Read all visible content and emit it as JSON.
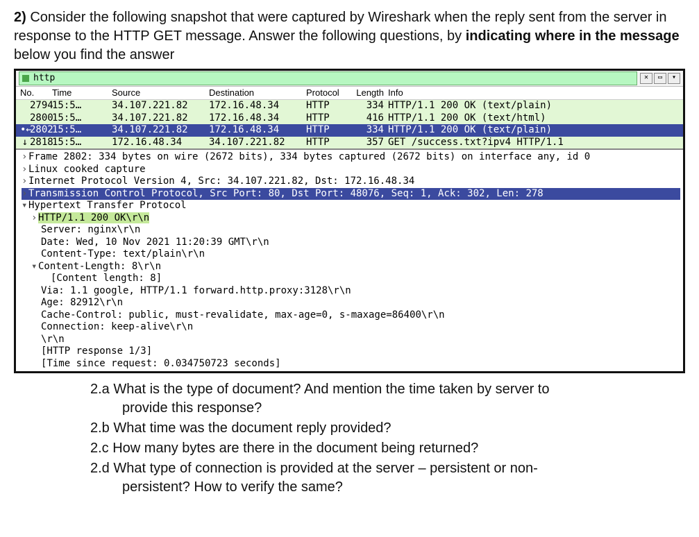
{
  "intro": {
    "num": "2)",
    "t1": " Consider the following snapshot that were captured by Wireshark when the reply sent from the server in response to the HTTP GET message. Answer the following questions, by ",
    "bold": "indicating where in the message",
    "t2": " below you find the answer"
  },
  "filter": {
    "text": "http",
    "btn_x": "✕",
    "btn_sq": "▭",
    "btn_dd": "▾"
  },
  "headers": {
    "no": "No.",
    "time": "Time",
    "src": "Source",
    "dst": "Destination",
    "prot": "Protocol",
    "len": "Length",
    "info": "Info"
  },
  "rows": [
    {
      "marker": " ",
      "no": "2794",
      "time": "15:5…",
      "src": "34.107.221.82",
      "dst": "172.16.48.34",
      "prot": "HTTP",
      "len": "334",
      "info": "HTTP/1.1 200 OK  (text/plain)",
      "cls": "row-green"
    },
    {
      "marker": " ",
      "no": "2800",
      "time": "15:5…",
      "src": "34.107.221.82",
      "dst": "172.16.48.34",
      "prot": "HTTP",
      "len": "416",
      "info": "HTTP/1.1 200 OK  (text/html)",
      "cls": "row-green"
    },
    {
      "marker": "•←",
      "no": "2802",
      "time": "15:5…",
      "src": "34.107.221.82",
      "dst": "172.16.48.34",
      "prot": "HTTP",
      "len": "334",
      "info": "HTTP/1.1 200 OK  (text/plain)",
      "cls": "row-sel"
    },
    {
      "marker": "↓",
      "no": "2818",
      "time": "15:5…",
      "src": "172.16.48.34",
      "dst": "34.107.221.82",
      "prot": "HTTP",
      "len": "357",
      "info": "GET /success.txt?ipv4 HTTP/1.1",
      "cls": "row-green"
    }
  ],
  "tree": {
    "l1": "Frame 2802: 334 bytes on wire (2672 bits), 334 bytes captured (2672 bits) on interface any, id 0",
    "l2": "Linux cooked capture",
    "l3": "Internet Protocol Version 4, Src: 34.107.221.82, Dst: 172.16.48.34",
    "l4": "Transmission Control Protocol, Src Port: 80, Dst Port: 48076, Seq: 1, Ack: 302, Len: 278",
    "l5": "Hypertext Transfer Protocol",
    "l6": "HTTP/1.1 200 OK\\r\\n",
    "l7": "Server: nginx\\r\\n",
    "l8": "Date: Wed, 10 Nov 2021 11:20:39 GMT\\r\\n",
    "l9": "Content-Type: text/plain\\r\\n",
    "l10": "Content-Length: 8\\r\\n",
    "l11": "[Content length: 8]",
    "l12": "Via: 1.1 google, HTTP/1.1 forward.http.proxy:3128\\r\\n",
    "l13": "Age: 82912\\r\\n",
    "l14": "Cache-Control: public, must-revalidate, max-age=0, s-maxage=86400\\r\\n",
    "l15": "Connection: keep-alive\\r\\n",
    "l16": "\\r\\n",
    "l17": "[HTTP response 1/3]",
    "l18": "[Time since request: 0.034750723 seconds]"
  },
  "questions": {
    "a_l1": "2.a What is the type of document? And mention the time taken by server to",
    "a_l2": "provide this response?",
    "b": "2.b What time was the document reply provided?",
    "c": "2.c How many bytes are there in the document being returned?",
    "d_l1": "2.d What type of connection is provided at the server – persistent or non-",
    "d_l2": "persistent? How to verify the same?"
  }
}
